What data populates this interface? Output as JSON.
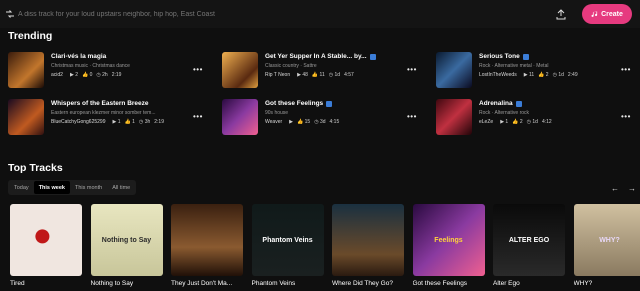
{
  "prompt": {
    "placeholder": "A diss track for your loud upstairs neighbor, hip hop, East Coast",
    "create_label": "Create"
  },
  "trending": {
    "title": "Trending",
    "items": [
      {
        "title": "Clari-vés la magia",
        "genre": "Christmas music · Christmas dance",
        "artist": "acid2",
        "plays": "2",
        "likes": "0",
        "age": "2h",
        "duration": "2:19",
        "badge": "",
        "accent": "#c2762c"
      },
      {
        "title": "Get Yer Supper In A Stable... by...",
        "genre": "Classic country · Sattre",
        "artist": "Rip T Neon",
        "plays": "48",
        "likes": "11",
        "age": "1d",
        "duration": "4:57",
        "badge": "square",
        "accent": "#e0a040"
      },
      {
        "title": "Serious Tone",
        "genre": "Rock · Alternative metal · Metal",
        "artist": "LostInTheWeeds",
        "plays": "11",
        "likes": "2",
        "age": "1d",
        "duration": "2:49",
        "badge": "square",
        "accent": "#3a6aa0"
      },
      {
        "title": "Whispers of the Eastern Breeze",
        "genre": "Eastern european klezmer minor somber tem...",
        "artist": "BlueCatchyGong625299",
        "plays": "1",
        "likes": "1",
        "age": "3h",
        "duration": "2:19",
        "badge": "",
        "accent": "#c05a20"
      },
      {
        "title": "Got these Feelings",
        "genre": "90s house",
        "artist": "Weaver",
        "plays": "",
        "likes": "15",
        "age": "3d",
        "duration": "4:15",
        "badge": "note",
        "accent": "#8a3aa0"
      },
      {
        "title": "Adrenalina",
        "genre": "Rock · Alternative rock",
        "artist": "eLeZe",
        "plays": "1",
        "likes": "2",
        "age": "1d",
        "duration": "4:12",
        "badge": "note",
        "accent": "#c03040"
      }
    ]
  },
  "top_tracks": {
    "title": "Top Tracks",
    "tabs": [
      "Today",
      "This week",
      "This month",
      "All time"
    ],
    "active_tab": "This week",
    "items": [
      {
        "name": "Tired"
      },
      {
        "name": "Nothing to Say",
        "art_text": "Nothing to Say"
      },
      {
        "name": "They Just Don't Ma..."
      },
      {
        "name": "Phantom Veins",
        "art_text": "Phantom Veins"
      },
      {
        "name": "Where Did They Go?"
      },
      {
        "name": "Got these Feelings",
        "art_text": "Feelings"
      },
      {
        "name": "Alter Ego",
        "art_text": "ALTER EGO"
      },
      {
        "name": "WHY?",
        "art_text": "WHY?"
      }
    ]
  },
  "colors": {
    "accent": "#e63a7f",
    "badge_blue": "#3b7dd8"
  }
}
